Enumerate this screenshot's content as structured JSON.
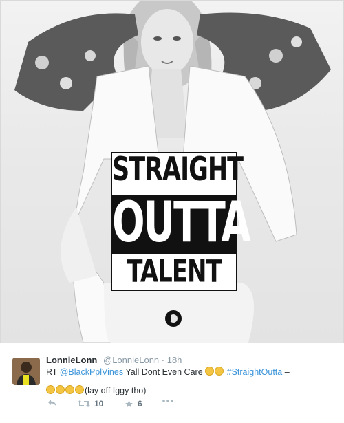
{
  "poster": {
    "line1": "STRAIGHT",
    "line2": "OUTTA",
    "line3": "TALENT",
    "logo_icon": "beats-logo-icon"
  },
  "tweet": {
    "display_name": "LonnieLonn",
    "handle": "@LonnieLonn",
    "time": "· 18h",
    "rt_prefix": "RT",
    "mention": "@BlackPplVines",
    "body_text": "Yall Dont Even Care",
    "hashtag": "#StraightOutta",
    "trailing": "–",
    "line2_text": "(lay off Iggy tho)",
    "emoji_icon": "laughing-crying-emoji-icon",
    "actions": {
      "reply_icon": "reply-icon",
      "retweet_icon": "retweet-icon",
      "retweet_count": "10",
      "favorite_icon": "star-icon",
      "favorite_count": "6",
      "more_icon": "more-icon"
    },
    "colors": {
      "link": "#3b94d9",
      "name": "#292f33",
      "muted": "#8899a6"
    }
  }
}
